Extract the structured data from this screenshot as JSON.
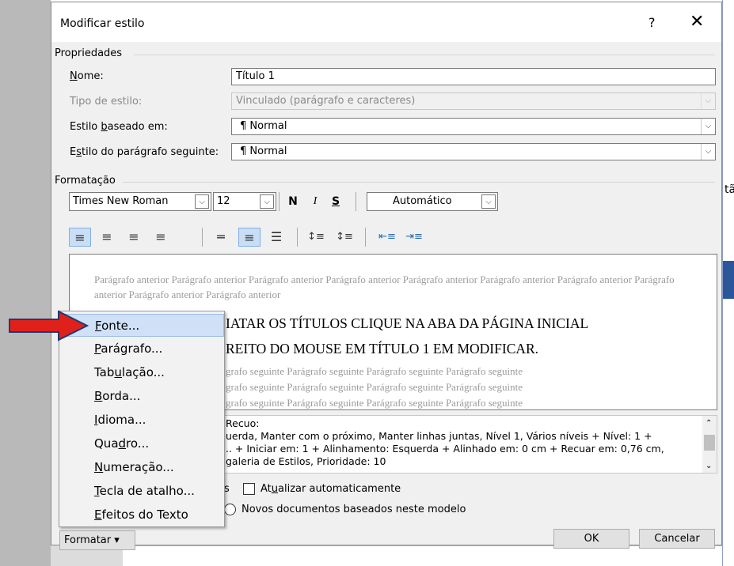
{
  "dialog": {
    "title": "Modificar estilo",
    "help_label": "?",
    "close_label": "✕"
  },
  "properties": {
    "section": "Propriedades",
    "name_label": "Nome:",
    "name_value": "Título 1",
    "style_type_label": "Tipo de estilo:",
    "style_type_value": "Vinculado (parágrafo e caracteres)",
    "based_on_label": "Estilo baseado em:",
    "based_on_value": "¶  Normal",
    "next_style_label": "Estilo do parágrafo seguinte:",
    "next_style_value": "¶  Normal"
  },
  "formatting": {
    "section": "Formatação",
    "font": "Times New Roman",
    "size": "12",
    "bold": "N",
    "italic": "I",
    "underline": "S",
    "color": "Automático"
  },
  "preview": {
    "prev_para": "Parágrafo anterior Parágrafo anterior Parágrafo anterior Parágrafo anterior Parágrafo anterior Parágrafo anterior Parágrafo anterior Parágrafo anterior Parágrafo anterior Parágrafo anterior",
    "line1": "IATAR OS TÍTULOS CLIQUE NA ABA DA PÁGINA INICIAL",
    "line2": "REITO DO MOUSE EM TÍTULO 1 EM MODIFICAR.",
    "next1": "grafo seguinte Parágrafo seguinte Parágrafo seguinte Parágrafo seguinte",
    "next2": "grafo seguinte Parágrafo seguinte Parágrafo seguinte Parágrafo seguinte",
    "next3": "grafo seguinte Parágrafo seguinte Parágrafo seguinte Parágrafo seguinte"
  },
  "description": {
    "line1": "Recuo:",
    "line2": "uerda, Manter com o próximo, Manter linhas juntas, Nível 1, Vários níveis + Nível: 1 +",
    "line3": ".. + Iniciar em: 1 + Alinhamento: Esquerda + Alinhado em:  0 cm + Recuar em:  0,76 cm,",
    "line4": "galeria de Estilos, Prioridade: 10"
  },
  "options": {
    "partial_s": "s",
    "auto_update": "Atualizar automaticamente",
    "new_docs": "Novos documentos baseados neste modelo"
  },
  "buttons": {
    "format": "Formatar ▾",
    "ok": "OK",
    "cancel": "Cancelar"
  },
  "menu": {
    "items": [
      {
        "pre": "",
        "key": "F",
        "post": "onte..."
      },
      {
        "pre": "",
        "key": "P",
        "post": "arágrafo..."
      },
      {
        "pre": "Tab",
        "key": "u",
        "post": "lação..."
      },
      {
        "pre": "",
        "key": "B",
        "post": "orda..."
      },
      {
        "pre": "",
        "key": "I",
        "post": "dioma..."
      },
      {
        "pre": "Qua",
        "key": "d",
        "post": "ro..."
      },
      {
        "pre": "",
        "key": "N",
        "post": "umeração..."
      },
      {
        "pre": "",
        "key": "T",
        "post": "ecla de atalho..."
      },
      {
        "pre": "",
        "key": "E",
        "post": "feitos do Texto"
      }
    ]
  },
  "background": {
    "right_partial": "tã"
  },
  "colors": {
    "arrow": "#e0201b",
    "menu_highlight": "#cfe0f7",
    "ribbon_blue": "#2b579a"
  },
  "icons": [
    "align-left-icon",
    "align-center-icon",
    "align-right-icon",
    "justify-icon",
    "single-spacing-icon",
    "one-half-spacing-icon",
    "double-spacing-icon",
    "space-before-icon",
    "space-after-icon",
    "decrease-indent-icon",
    "increase-indent-icon",
    "arrow-pointer-icon"
  ]
}
